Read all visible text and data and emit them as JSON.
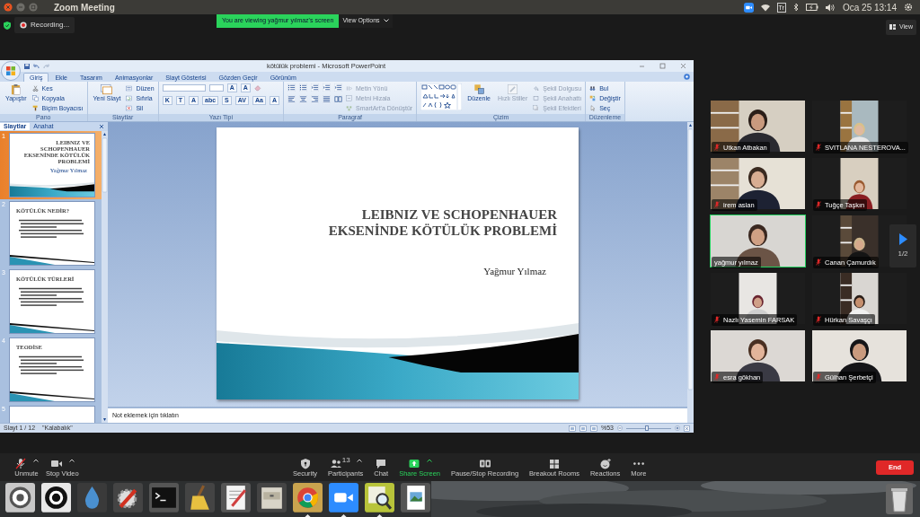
{
  "window": {
    "title": "Zoom Meeting"
  },
  "tray": {
    "keyboard": "Tr",
    "clock": "Oca 25 13:14"
  },
  "meeting_bar": {
    "recording": "Recording...",
    "banner": "You are viewing yağmur yılmaz's screen",
    "view_options": "View Options",
    "view": "View"
  },
  "shared_screen": {
    "title": "kötülük problemi - Microsoft PowerPoint",
    "tabs": [
      {
        "label": "Giriş",
        "selected": true
      },
      {
        "label": "Ekle",
        "selected": false
      },
      {
        "label": "Tasarım",
        "selected": false
      },
      {
        "label": "Animasyonlar",
        "selected": false
      },
      {
        "label": "Slayt Gösterisi",
        "selected": false
      },
      {
        "label": "Gözden Geçir",
        "selected": false
      },
      {
        "label": "Görünüm",
        "selected": false
      }
    ],
    "ribbon": [
      {
        "label": "Pano",
        "kind": "clipboard",
        "large": [
          {
            "label": "Yapıştır",
            "disabled": false
          }
        ],
        "items": [
          {
            "label": "Kes",
            "disabled": false
          },
          {
            "label": "Kopyala",
            "disabled": false
          },
          {
            "label": "Biçim Boyacısı",
            "disabled": false
          }
        ]
      },
      {
        "label": "Slaytlar",
        "kind": "slides",
        "large": [
          {
            "label": "Yeni Slayt",
            "disabled": false
          }
        ],
        "items": [
          {
            "label": "Düzen",
            "disabled": false
          },
          {
            "label": "Sıfırla",
            "disabled": false
          },
          {
            "label": "Sil",
            "disabled": false
          }
        ]
      },
      {
        "label": "Yazı Tipi",
        "kind": "font",
        "size_buttons": [
          "A",
          "A"
        ],
        "format_buttons": [
          "K",
          "T",
          "A",
          "abc",
          "S",
          "AV",
          "Aa",
          "A"
        ]
      },
      {
        "label": "Paragraf",
        "kind": "paragraph",
        "items": [
          {
            "label": "Metin Yönü",
            "disabled": true
          },
          {
            "label": "Metni Hizala",
            "disabled": true
          },
          {
            "label": "SmartArt'a Dönüştür",
            "disabled": true
          }
        ]
      },
      {
        "label": "Çizim",
        "kind": "drawing",
        "large": [
          {
            "label": "Düzenle",
            "disabled": false
          },
          {
            "label": "Hızlı Stiller",
            "disabled": true
          }
        ],
        "items": [
          {
            "label": "Şekil Dolgusu",
            "disabled": true
          },
          {
            "label": "Şekil Anahattı",
            "disabled": true
          },
          {
            "label": "Şekil Efektleri",
            "disabled": true
          }
        ]
      },
      {
        "label": "Düzenleme",
        "kind": "editing",
        "items": [
          {
            "label": "Bul",
            "disabled": false
          },
          {
            "label": "Değiştir",
            "disabled": false
          },
          {
            "label": "Seç",
            "disabled": false
          }
        ]
      }
    ],
    "pane_tabs": [
      {
        "label": "Slaytlar",
        "selected": true
      },
      {
        "label": "Anahat",
        "selected": false
      }
    ],
    "thumbnails": [
      {
        "number": "1",
        "selected": true,
        "kind": "title",
        "title_lines": [
          "LEIBNIZ VE SCHOPENHAUER",
          "EKSENİNDE KÖTÜLÜK PROBLEMİ"
        ],
        "subtitle": "Yağmur Yılmaz"
      },
      {
        "number": "2",
        "selected": false,
        "kind": "bullets",
        "title": "KÖTÜLÜK NEDİR?"
      },
      {
        "number": "3",
        "selected": false,
        "kind": "bullets",
        "title": "KÖTÜLÜK TÜRLERİ"
      },
      {
        "number": "4",
        "selected": false,
        "kind": "bullets",
        "title": "TEODİSE"
      },
      {
        "number": "5",
        "selected": false,
        "kind": "partial"
      }
    ],
    "slide": {
      "title_lines": [
        "LEIBNIZ VE SCHOPENHAUER",
        "EKSENİNDE KÖTÜLÜK PROBLEMİ"
      ],
      "subtitle": "Yağmur Yılmaz"
    },
    "notes": {
      "placeholder": "Not eklemek için tıklatın"
    },
    "status": {
      "slide": "Slayt 1 / 12",
      "theme": "\"Kalabalık\"",
      "zoom": {
        "label": "%53",
        "level": 0.45
      }
    }
  },
  "participants": [
    {
      "name": "Utkan Atbakan",
      "muted": true,
      "speaking": false,
      "kind": "wide"
    },
    {
      "name": "SVITLANA NESTEROVA...",
      "muted": true,
      "speaking": false,
      "kind": "portrait"
    },
    {
      "name": "irem aslan",
      "muted": true,
      "speaking": false,
      "kind": "wide"
    },
    {
      "name": "Tuğçe Taşkın",
      "muted": true,
      "speaking": false,
      "kind": "portrait"
    },
    {
      "name": "yağmur yılmaz",
      "muted": false,
      "speaking": true,
      "kind": "wide"
    },
    {
      "name": "Canan Çamurdık",
      "muted": true,
      "speaking": false,
      "kind": "portrait"
    },
    {
      "name": "Nazlı Yasemin FARSAK",
      "muted": true,
      "speaking": false,
      "kind": "portrait"
    },
    {
      "name": "Hürkan Savaşçı",
      "muted": true,
      "speaking": false,
      "kind": "portrait"
    },
    {
      "name": "esra gökhan",
      "muted": true,
      "speaking": false,
      "kind": "wide"
    },
    {
      "name": "Gülhan Şerbetçi",
      "muted": true,
      "speaking": false,
      "kind": "wide"
    }
  ],
  "gallery_page": "1/2",
  "toolbar": [
    {
      "label": "Unmute",
      "caret": true,
      "accent": false
    },
    {
      "label": "Stop Video",
      "caret": true,
      "accent": false
    },
    {
      "label": "Security",
      "caret": false,
      "accent": false
    },
    {
      "label": "Participants",
      "count": "13",
      "caret": true,
      "accent": false
    },
    {
      "label": "Chat",
      "caret": false,
      "accent": false
    },
    {
      "label": "Share Screen",
      "caret": true,
      "accent": true
    },
    {
      "label": "Pause/Stop Recording",
      "caret": false,
      "accent": false
    },
    {
      "label": "Breakout Rooms",
      "caret": false,
      "accent": false
    },
    {
      "label": "Reactions",
      "caret": false,
      "accent": false
    },
    {
      "label": "More",
      "caret": false,
      "accent": false
    }
  ],
  "end_button": "End",
  "dock": {
    "items": [
      {
        "running": false
      },
      {
        "running": false
      },
      {
        "running": false
      },
      {
        "running": false
      },
      {
        "running": false
      },
      {
        "running": false
      },
      {
        "running": false
      },
      {
        "running": false
      },
      {
        "running": true
      },
      {
        "running": true
      },
      {
        "running": true
      },
      {
        "running": false
      }
    ]
  }
}
